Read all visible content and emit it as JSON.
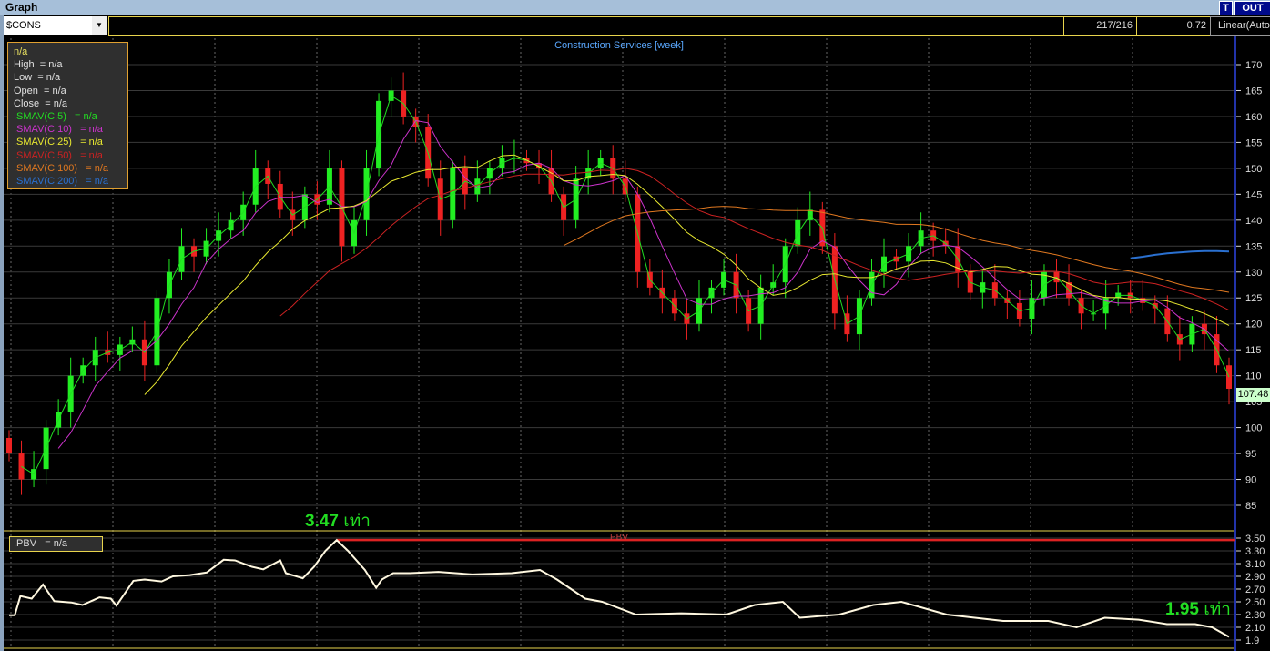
{
  "window": {
    "title": "Graph",
    "btn_t": "T",
    "btn_out": "OUT"
  },
  "toolbar": {
    "symbol": "$CONS",
    "bar_count": "217/216",
    "value": "0.72",
    "scale": "Linear(Auto"
  },
  "chart": {
    "title": "Construction Services [week]",
    "last_price": "107.48",
    "annotation_high": {
      "value": "3.47",
      "unit": "เท่า"
    },
    "annotation_last": {
      "value": "1.95",
      "unit": "เท่า"
    }
  },
  "legend": {
    "items": [
      {
        "label": "n/a",
        "color": "#e8e060"
      },
      {
        "label": "High  = n/a",
        "color": "#e0e0e0"
      },
      {
        "label": "Low  = n/a",
        "color": "#e0e0e0"
      },
      {
        "label": "Open  = n/a",
        "color": "#e0e0e0"
      },
      {
        "label": "Close  = n/a",
        "color": "#e0e0e0"
      },
      {
        "label": ".SMAV(C,5)   = n/a",
        "color": "#22dd22"
      },
      {
        "label": ".SMAV(C,10)   = n/a",
        "color": "#cc33cc"
      },
      {
        "label": ".SMAV(C,25)   = n/a",
        "color": "#e8e830"
      },
      {
        "label": ".SMAV(C,50)   = n/a",
        "color": "#cc2222"
      },
      {
        "label": ".SMAV(C,100)   = n/a",
        "color": "#e07820"
      },
      {
        "label": ".SMAV(C,200)   = n/a",
        "color": "#2a70d0"
      }
    ]
  },
  "pbv_panel": {
    "legend": ".PBV   = n/a",
    "title": "PBV"
  },
  "chart_data": [
    {
      "type": "candlestick",
      "title": "Construction Services [week]",
      "ylim": [
        82,
        173
      ],
      "yticks": [
        85,
        90,
        95,
        100,
        105,
        110,
        115,
        120,
        125,
        130,
        135,
        140,
        145,
        150,
        155,
        160,
        165,
        170
      ],
      "sma_periods": [
        5,
        10,
        25,
        50,
        100,
        200
      ],
      "closes": [
        95,
        90,
        92,
        100,
        103,
        110,
        112,
        115,
        114,
        116,
        117,
        112,
        125,
        130,
        135,
        133,
        136,
        138,
        140,
        143,
        150,
        147,
        142,
        140,
        145,
        143,
        150,
        135,
        140,
        150,
        163,
        165,
        160,
        158,
        148,
        140,
        150,
        145,
        148,
        150,
        152,
        152,
        151,
        150,
        145,
        140,
        148,
        150,
        152,
        148,
        145,
        130,
        127,
        125,
        122,
        120,
        125,
        127,
        130,
        125,
        120,
        127,
        128,
        135,
        140,
        142,
        135,
        122,
        118,
        125,
        130,
        133,
        132,
        135,
        138,
        136,
        135,
        130,
        126,
        128,
        125,
        124,
        121,
        125,
        130,
        128,
        125,
        122,
        122,
        125,
        126,
        125,
        124,
        123,
        118,
        116,
        120,
        118,
        112,
        107.48
      ]
    },
    {
      "type": "line",
      "title": "PBV",
      "ylim": [
        1.85,
        3.55
      ],
      "yticks": [
        "3.50",
        "3.30",
        "3.10",
        "2.90",
        "2.70",
        "2.50",
        "2.30",
        "2.10",
        "1.9"
      ],
      "max_weeks": 216,
      "max_line": 3.47,
      "points": [
        [
          0,
          2.29
        ],
        [
          1,
          2.29
        ],
        [
          2,
          2.59
        ],
        [
          4,
          2.55
        ],
        [
          6,
          2.77
        ],
        [
          8,
          2.51
        ],
        [
          11,
          2.49
        ],
        [
          13,
          2.45
        ],
        [
          15,
          2.53
        ],
        [
          16,
          2.57
        ],
        [
          18,
          2.55
        ],
        [
          19,
          2.44
        ],
        [
          22,
          2.83
        ],
        [
          24,
          2.85
        ],
        [
          27,
          2.82
        ],
        [
          29,
          2.9
        ],
        [
          32,
          2.92
        ],
        [
          35,
          2.96
        ],
        [
          38,
          3.16
        ],
        [
          40,
          3.15
        ],
        [
          43,
          3.05
        ],
        [
          45,
          3.01
        ],
        [
          48,
          3.15
        ],
        [
          49,
          2.95
        ],
        [
          52,
          2.87
        ],
        [
          54,
          3.05
        ],
        [
          56,
          3.3
        ],
        [
          58,
          3.47
        ],
        [
          60,
          3.3
        ],
        [
          63,
          3.0
        ],
        [
          65,
          2.72
        ],
        [
          66,
          2.85
        ],
        [
          68,
          2.95
        ],
        [
          71,
          2.95
        ],
        [
          76,
          2.97
        ],
        [
          82,
          2.93
        ],
        [
          89,
          2.95
        ],
        [
          94,
          3.0
        ],
        [
          97,
          2.85
        ],
        [
          102,
          2.55
        ],
        [
          105,
          2.5
        ],
        [
          111,
          2.3
        ],
        [
          119,
          2.32
        ],
        [
          127,
          2.3
        ],
        [
          132,
          2.45
        ],
        [
          137,
          2.5
        ],
        [
          140,
          2.25
        ],
        [
          147,
          2.3
        ],
        [
          153,
          2.45
        ],
        [
          158,
          2.5
        ],
        [
          166,
          2.3
        ],
        [
          176,
          2.2
        ],
        [
          184,
          2.2
        ],
        [
          189,
          2.1
        ],
        [
          194,
          2.25
        ],
        [
          200,
          2.22
        ],
        [
          205,
          2.15
        ],
        [
          210,
          2.15
        ],
        [
          213,
          2.1
        ],
        [
          216,
          1.95
        ]
      ]
    }
  ]
}
